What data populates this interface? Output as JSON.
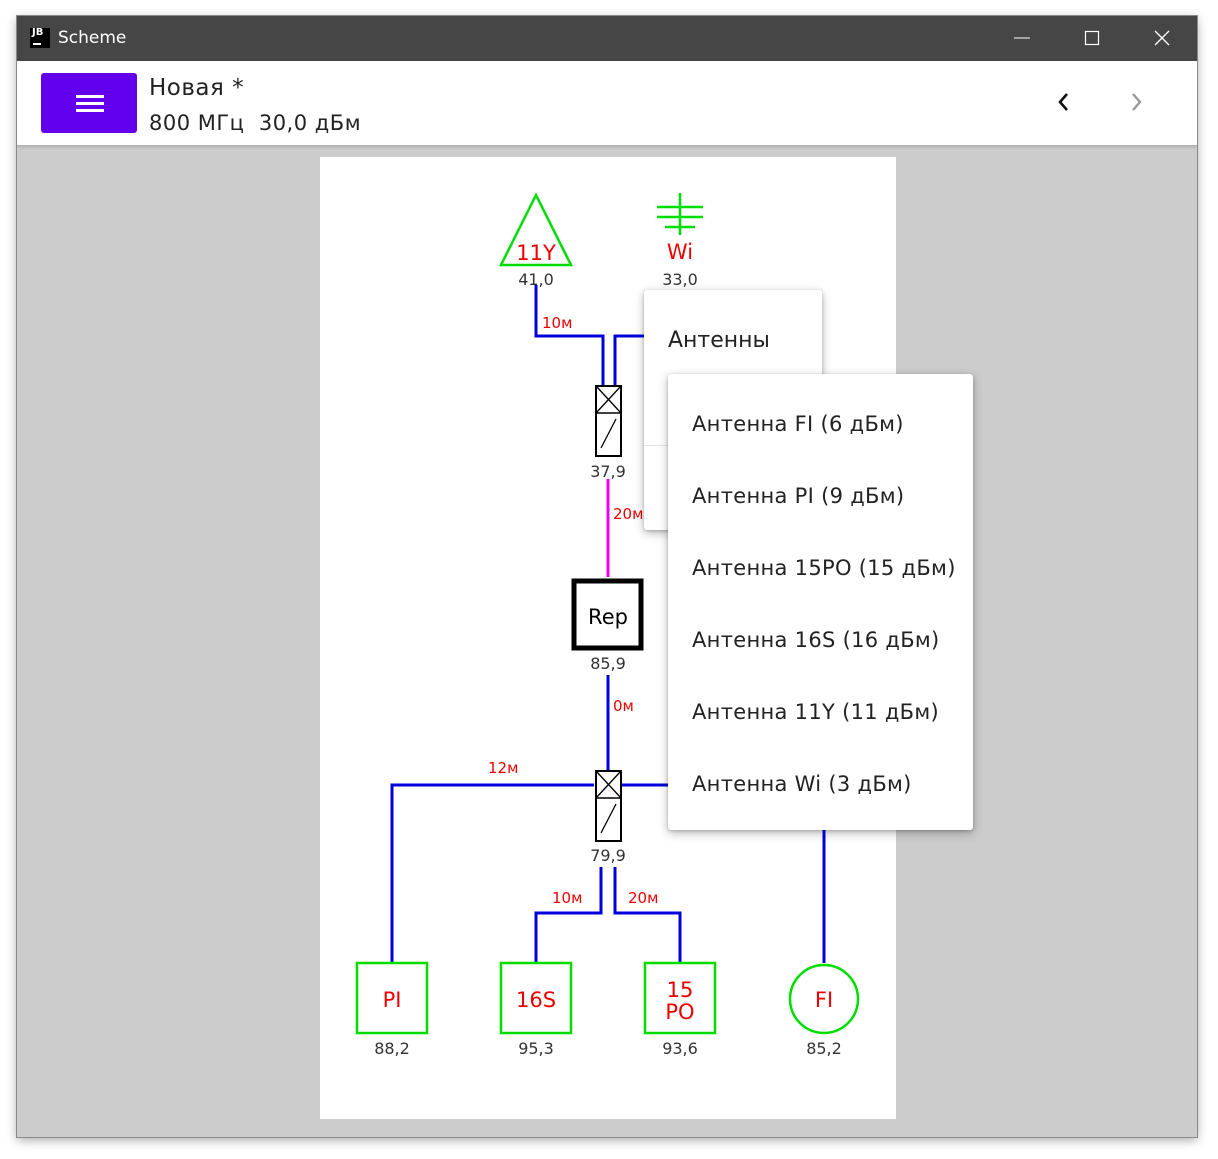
{
  "window": {
    "logo": "JB",
    "title": "Scheme",
    "controls": [
      "minimize-icon",
      "maximize-icon",
      "close-icon"
    ]
  },
  "appbar": {
    "menu_icon": "hamburger-menu-icon",
    "title": "Новая *",
    "subtitle": "800 МГц  30,0 дБм",
    "nav_back_icon": "chevron-left-icon",
    "nav_forward_icon": "chevron-right-icon"
  },
  "scheme": {
    "antennas": [
      {
        "label": "11Y",
        "value": "41,0",
        "shape": "triangle"
      },
      {
        "label": "Wi",
        "value": "33,0",
        "shape": "cross"
      }
    ],
    "splitter_top_value": "37,9",
    "repeater": {
      "label": "Rep",
      "value": "85,9"
    },
    "splitter_bottom_value": "79,9",
    "cables": [
      "10м",
      "20м",
      "0м",
      "12м",
      "10м",
      "20м"
    ],
    "bottom_nodes": [
      {
        "label": "PI",
        "value": "88,2",
        "shape": "square"
      },
      {
        "label": "16S",
        "value": "95,3",
        "shape": "square"
      },
      {
        "label_line1": "15",
        "label_line2": "PO",
        "value": "93,6",
        "shape": "square"
      },
      {
        "label": "FI",
        "value": "85,2",
        "shape": "circle"
      }
    ],
    "colors": {
      "cable": "#0000dd",
      "cable_rep": "#ee00ee",
      "antenna": "#00dd00",
      "label": "#ee0000"
    }
  },
  "context_menu": {
    "item": "Антенны"
  },
  "submenu": {
    "items": [
      "Антенна FI (6 дБм)",
      "Антенна PI (9 дБм)",
      "Антенна 15PO (15 дБм)",
      "Антенна 16S (16 дБм)",
      "Антенна 11Y (11 дБм)",
      "Антенна Wi (3 дБм)"
    ]
  }
}
